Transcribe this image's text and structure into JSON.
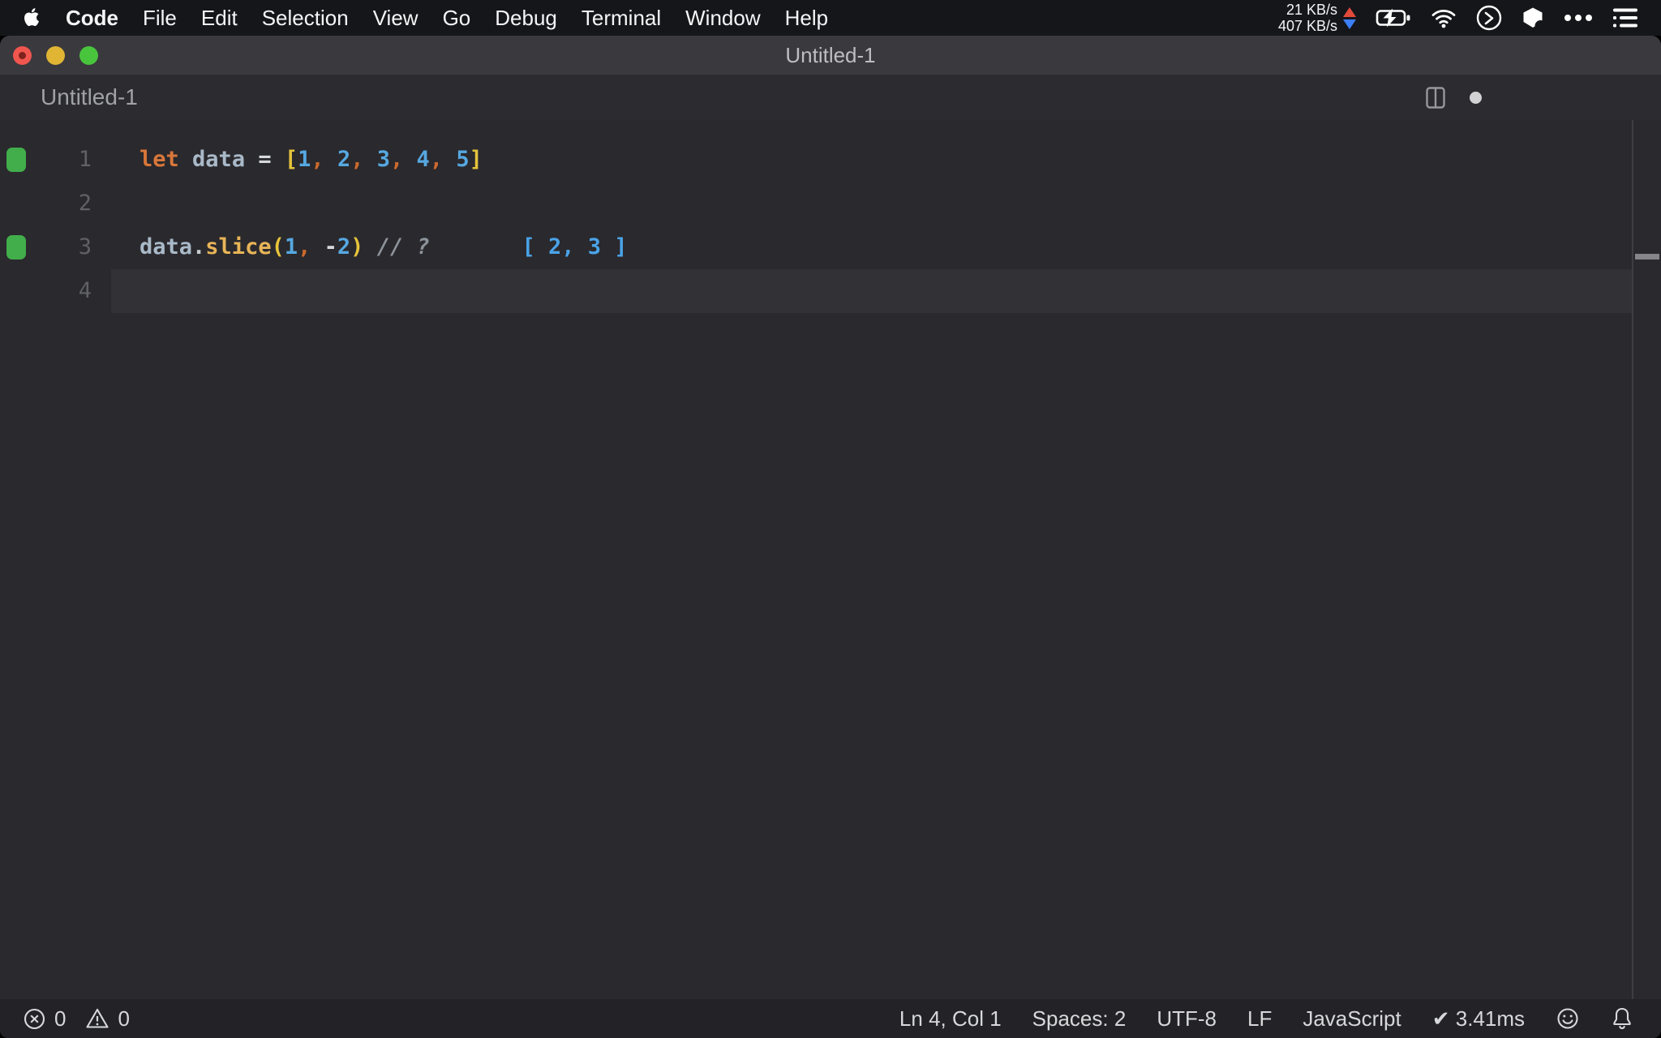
{
  "menubar": {
    "apple_icon": "apple-logo-icon",
    "menus": [
      "Code",
      "File",
      "Edit",
      "Selection",
      "View",
      "Go",
      "Debug",
      "Terminal",
      "Window",
      "Help"
    ],
    "network": {
      "up": "21 KB/s",
      "down": "407 KB/s"
    },
    "status_icons": [
      "battery-charging-icon",
      "wifi-icon",
      "terminal-circle-icon",
      "cube-icon",
      "ellipsis-icon",
      "list-menu-icon"
    ]
  },
  "window": {
    "title": "Untitled-1",
    "tab_label": "Untitled-1",
    "header_icons": [
      "split-editor-icon",
      "unsaved-dot"
    ]
  },
  "editor": {
    "lines": [
      {
        "number": "1",
        "marker": true,
        "current": false,
        "tokens": [
          {
            "t": "let",
            "c": "kw"
          },
          {
            "t": " "
          },
          {
            "t": "data",
            "c": "id"
          },
          {
            "t": " "
          },
          {
            "t": "=",
            "c": "op"
          },
          {
            "t": " "
          },
          {
            "t": "[",
            "c": "br"
          },
          {
            "t": "1",
            "c": "num"
          },
          {
            "t": ",",
            "c": "cm"
          },
          {
            "t": " "
          },
          {
            "t": "2",
            "c": "num"
          },
          {
            "t": ",",
            "c": "cm"
          },
          {
            "t": " "
          },
          {
            "t": "3",
            "c": "num"
          },
          {
            "t": ",",
            "c": "cm"
          },
          {
            "t": " "
          },
          {
            "t": "4",
            "c": "num"
          },
          {
            "t": ",",
            "c": "cm"
          },
          {
            "t": " "
          },
          {
            "t": "5",
            "c": "num"
          },
          {
            "t": "]",
            "c": "br"
          }
        ]
      },
      {
        "number": "2",
        "marker": false,
        "current": false,
        "tokens": []
      },
      {
        "number": "3",
        "marker": true,
        "current": false,
        "tokens": [
          {
            "t": "data",
            "c": "id"
          },
          {
            "t": ".",
            "c": "dot"
          },
          {
            "t": "slice",
            "c": "fn"
          },
          {
            "t": "(",
            "c": "pr"
          },
          {
            "t": "1",
            "c": "num"
          },
          {
            "t": ",",
            "c": "cm"
          },
          {
            "t": " "
          },
          {
            "t": "-",
            "c": "op"
          },
          {
            "t": "2",
            "c": "num"
          },
          {
            "t": ")",
            "c": "pr"
          },
          {
            "t": " "
          },
          {
            "t": "// ?",
            "c": "cmt"
          },
          {
            "t": "       [ 2, 3 ]",
            "c": "out"
          }
        ]
      },
      {
        "number": "4",
        "marker": false,
        "current": true,
        "tokens": []
      }
    ],
    "gutter_marker_icon": "quokka-coverage-marker"
  },
  "statusbar": {
    "errors": "0",
    "warnings": "0",
    "error_icon": "error-circle-icon",
    "warning_icon": "warning-triangle-icon",
    "items": [
      "Ln 4, Col 1",
      "Spaces: 2",
      "UTF-8",
      "LF",
      "JavaScript",
      "✔ 3.41ms"
    ],
    "right_icons": [
      "smiley-feedback-icon",
      "bell-notifications-icon"
    ]
  },
  "colors": {
    "desktop": "#000000",
    "menubar_bg": "#15161a",
    "menubar_text": "#f5f5f7",
    "titlebar_bg": "#3a393e",
    "titlebar_text": "#bdbec1",
    "header_bg": "#2c2b2f",
    "tab_text": "#a0a2a5",
    "editor_bg": "#2a292d",
    "line_highlight": "#323136",
    "gutter_num": "#606165",
    "marker_green": "#41ae4b",
    "ruler_line": "#3e3e42",
    "ruler_dash": "#86868a",
    "icon_gray": "#a6a7aa",
    "statusbar_bg": "#232327",
    "status_text": "#d7d8da",
    "tl_red": "#f1564e",
    "tl_red_dot": "#7e221d",
    "tl_yellow": "#e0b534",
    "tl_green": "#49c43d",
    "net_up": "#e04a3a",
    "net_down": "#3c7ef5",
    "kw": "#d9773a",
    "ident": "#a9b9c8",
    "op": "#d6d9dc",
    "sqbr": "#e4c33c",
    "num": "#56a8e1",
    "comma": "#cb6a2d",
    "dot": "#c6cacd",
    "fn": "#e7b458",
    "paren": "#e7c43b",
    "cmt": "#8d939a",
    "out": "#4aa3e8"
  }
}
